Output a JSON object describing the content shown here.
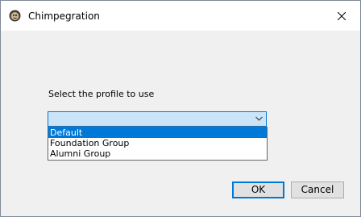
{
  "window": {
    "title": "Chimpegration"
  },
  "form": {
    "prompt": "Select the profile to use",
    "combo_value": "",
    "options": [
      {
        "label": "Default",
        "selected": true
      },
      {
        "label": "Foundation Group",
        "selected": false
      },
      {
        "label": "Alumni Group",
        "selected": false
      }
    ]
  },
  "buttons": {
    "ok_label": "OK",
    "cancel_label": "Cancel"
  },
  "colors": {
    "accent": "#0078d7",
    "combo_bg": "#cce4f7",
    "dialog_bg": "#f0f0f0"
  },
  "icons": {
    "app": "chimp-app-icon",
    "close": "close-icon",
    "dropdown": "chevron-down-icon"
  }
}
